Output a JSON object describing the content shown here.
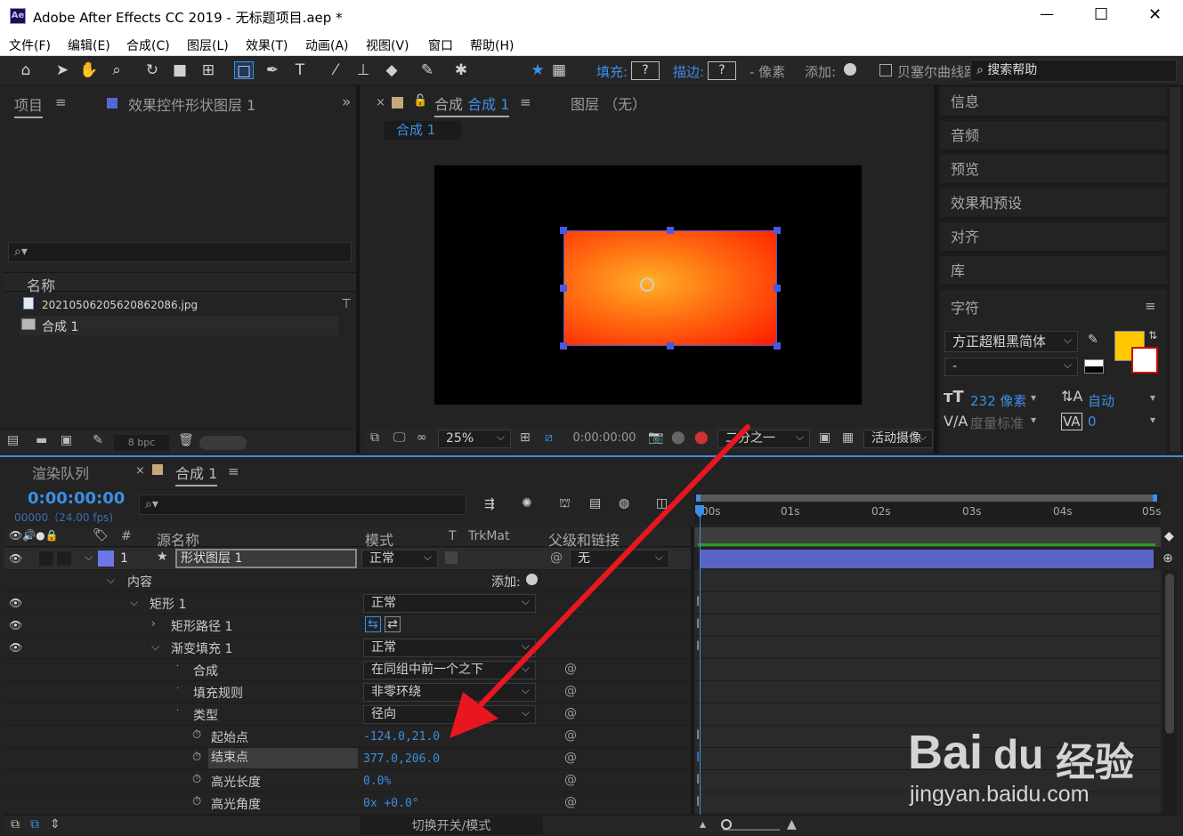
{
  "window": {
    "title": "Adobe After Effects CC 2019 - 无标题项目.aep *",
    "app_icon": "Ae",
    "minimize": "—",
    "maximize": "☐",
    "close": "✕"
  },
  "menu": [
    "文件(F)",
    "编辑(E)",
    "合成(C)",
    "图层(L)",
    "效果(T)",
    "动画(A)",
    "视图(V)",
    "窗口",
    "帮助(H)"
  ],
  "toolbar": {
    "fill_label": "填充:",
    "fill_value": "?",
    "stroke_label": "描边:",
    "stroke_value": "?",
    "stroke_unit": "- 像素",
    "add_label": "添加:",
    "bezier_label": "贝塞尔曲线路",
    "search_label": "搜索帮助"
  },
  "project_panel": {
    "tab_project": "项目",
    "tab_effects": "效果控件形状图层 1",
    "expand": "»",
    "search_placeholder": "",
    "col_name": "名称",
    "items": [
      {
        "icon": "image-icon",
        "name": "20210506205620862086.jpg"
      },
      {
        "icon": "composition-icon",
        "name": "合成 1"
      }
    ],
    "bpc": "8 bpc"
  },
  "comp_panel": {
    "tab_close": "×",
    "tab_label": "合成",
    "tab_name": "合成 1",
    "layer_tab": "图层 （无）",
    "sub_tab": "合成 1",
    "zoom": "25%",
    "timecode": "0:00:00:00",
    "resolution": "二分之一",
    "camera": "活动摄像"
  },
  "right_panel": {
    "items": [
      "信息",
      "音频",
      "预览",
      "效果和预设",
      "对齐",
      "库"
    ],
    "char_title": "字符",
    "font": "方正超粗黑简体",
    "style": "-",
    "size": "232 像素",
    "leading": "自动",
    "kerning": "度量标准",
    "tracking": "0",
    "fill_color": "#FFC800"
  },
  "timeline": {
    "tab_render": "渲染队列",
    "tab_comp": "合成 1",
    "timecode": "0:00:00:00",
    "frames": "00000（24.00 fps)",
    "search_placeholder": "",
    "headers": {
      "num": "#",
      "source": "源名称",
      "mode": "模式",
      "t": "T",
      "trkmat": "TrkMat",
      "parent": "父级和链接"
    },
    "ruler": [
      "00s",
      "01s",
      "02s",
      "03s",
      "04s",
      "05s"
    ],
    "layer": {
      "num": "1",
      "name": "形状图层 1",
      "mode": "正常",
      "parent": "无"
    },
    "props": [
      {
        "label": "内容",
        "extra": "添加:"
      },
      {
        "label": "矩形 1",
        "mode": "正常"
      },
      {
        "label": "矩形路径 1"
      },
      {
        "label": "渐变填充 1",
        "mode": "正常"
      },
      {
        "label": "合成",
        "mode": "在同组中前一个之下"
      },
      {
        "label": "填充规则",
        "mode": "非零环绕"
      },
      {
        "label": "类型",
        "mode": "径向"
      },
      {
        "label": "起始点",
        "value": "-124.0,21.0"
      },
      {
        "label": "结束点",
        "value": "377.0,206.0"
      },
      {
        "label": "高光长度",
        "value": "0.0%"
      },
      {
        "label": "高光角度",
        "value": "0x +0.0°"
      }
    ],
    "bottom_label": "切换开关/模式"
  },
  "watermark": {
    "brand": "Bai",
    "paw": "du",
    "suffix": "经验",
    "url": "jingyan.baidu.com"
  }
}
